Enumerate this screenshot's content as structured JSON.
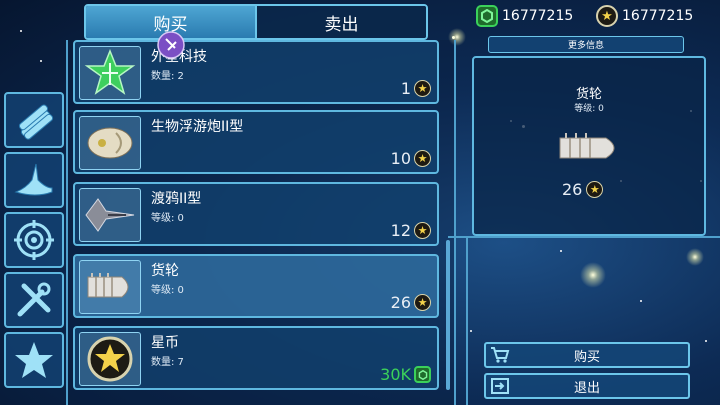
{
  "tabs": {
    "buy": "购买",
    "sell": "卖出"
  },
  "currency": {
    "gems": "16777215",
    "coins": "16777215"
  },
  "sidebar": [
    {
      "icon": "missiles-icon"
    },
    {
      "icon": "wing-icon"
    },
    {
      "icon": "crosshair-icon"
    },
    {
      "icon": "tools-icon"
    },
    {
      "icon": "star-icon"
    }
  ],
  "items": [
    {
      "name": "外星科技",
      "sub": "数量: 2",
      "price": "1",
      "currency": "coin"
    },
    {
      "name": "生物浮游炮II型",
      "sub": "",
      "price": "10",
      "currency": "coin"
    },
    {
      "name": "渡鸦II型",
      "sub": "等级:  0",
      "price": "12",
      "currency": "coin"
    },
    {
      "name": "货轮",
      "sub": "等级:  0",
      "price": "26",
      "currency": "coin"
    },
    {
      "name": "星币",
      "sub": "数量: 7",
      "price": "30K",
      "currency": "gem"
    }
  ],
  "info": {
    "more_info": "更多信息",
    "name": "货轮",
    "level": "等级:  0",
    "price": "26"
  },
  "actions": {
    "buy": "购买",
    "exit": "退出"
  },
  "colors": {
    "accent": "#5fb8e0",
    "gem": "#3bd15a",
    "coin": "#f3d24a"
  }
}
